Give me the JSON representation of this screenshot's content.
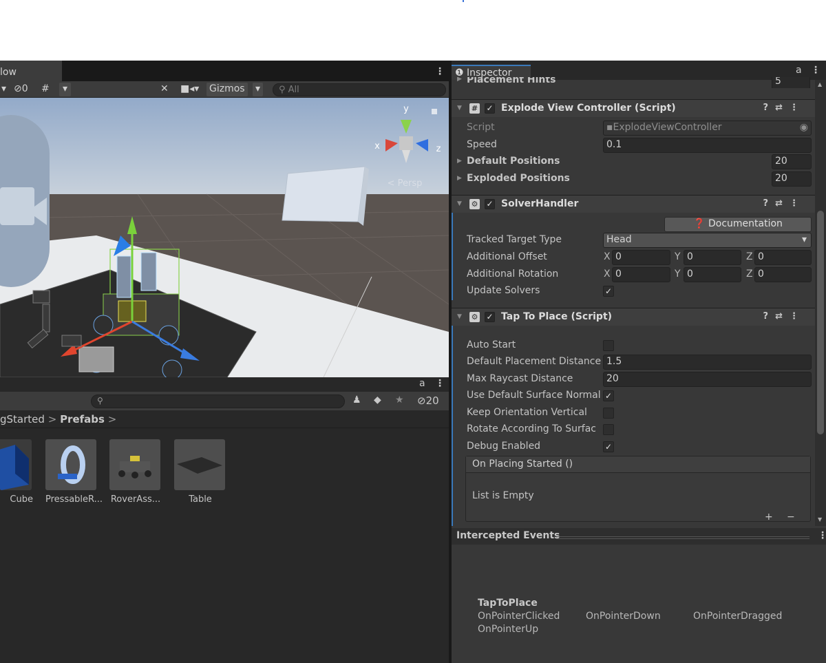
{
  "scene": {
    "tab_label": "low",
    "hidden_count": "0",
    "gizmos_label": "Gizmos",
    "search_placeholder": "All",
    "persp_label": "< Persp",
    "axes": {
      "x": "x",
      "y": "y",
      "z": "z"
    }
  },
  "project": {
    "hidden_count": "20",
    "breadcrumb": {
      "parent": "gStarted",
      "current": "Prefabs",
      "sep": ">"
    },
    "assets": [
      {
        "label": "Cube"
      },
      {
        "label": "PressableR..."
      },
      {
        "label": "RoverAss..."
      },
      {
        "label": "Table"
      }
    ]
  },
  "inspector": {
    "tab_label": "Inspector",
    "placement_hints": {
      "label": "Placement Hints",
      "value": "5"
    },
    "explode_view": {
      "title": "Explode View Controller (Script)",
      "script_label": "Script",
      "script_value": "ExplodeViewController",
      "speed_label": "Speed",
      "speed_value": "0.1",
      "default_positions_label": "Default Positions",
      "default_positions_value": "20",
      "exploded_positions_label": "Exploded Positions",
      "exploded_positions_value": "20"
    },
    "solver_handler": {
      "title": "SolverHandler",
      "documentation_label": "Documentation",
      "tracked_target_label": "Tracked Target Type",
      "tracked_target_value": "Head",
      "additional_offset_label": "Additional Offset",
      "offset": {
        "x": "0",
        "y": "0",
        "z": "0"
      },
      "additional_rotation_label": "Additional Rotation",
      "rotation": {
        "x": "0",
        "y": "0",
        "z": "0"
      },
      "update_solvers_label": "Update Solvers",
      "axis_labels": {
        "x": "X",
        "y": "Y",
        "z": "Z"
      }
    },
    "tap_to_place": {
      "title": "Tap To Place (Script)",
      "auto_start_label": "Auto Start",
      "default_distance_label": "Default Placement Distance",
      "default_distance_value": "1.5",
      "max_raycast_label": "Max Raycast Distance",
      "max_raycast_value": "20",
      "use_default_normal_label": "Use Default Surface Normal",
      "keep_vertical_label": "Keep Orientation Vertical",
      "rotate_surface_label": "Rotate According To Surfac",
      "debug_enabled_label": "Debug Enabled",
      "on_placing_started_label": "On Placing Started ()",
      "list_empty_label": "List is Empty",
      "add_label": "+",
      "remove_label": "−"
    }
  },
  "intercepted_events": {
    "header": "Intercepted Events",
    "component": "TapToPlace",
    "events": [
      "OnPointerClicked",
      "OnPointerDown",
      "OnPointerDragged",
      "OnPointerUp"
    ]
  },
  "colors": {
    "accent_blue": "#3a79bb",
    "panel_bg": "#383838",
    "dark_bg": "#282828"
  }
}
